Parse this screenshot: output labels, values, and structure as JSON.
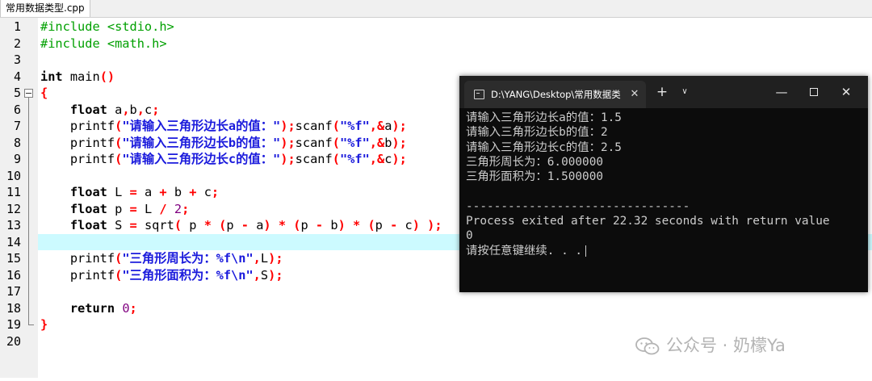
{
  "editor": {
    "tab_label": "常用数据类型.cpp",
    "highlighted_line": 14,
    "lines": [
      {
        "n": "1",
        "tokens": [
          {
            "c": "pp",
            "t": "#include <stdio.h>"
          }
        ]
      },
      {
        "n": "2",
        "tokens": [
          {
            "c": "pp",
            "t": "#include <math.h>"
          }
        ]
      },
      {
        "n": "3",
        "tokens": []
      },
      {
        "n": "4",
        "tokens": [
          {
            "c": "kw",
            "t": "int"
          },
          {
            "c": "plain",
            "t": " main"
          },
          {
            "c": "op",
            "t": "()"
          }
        ]
      },
      {
        "n": "5",
        "tokens": [
          {
            "c": "op",
            "t": "{"
          }
        ]
      },
      {
        "n": "6",
        "tokens": [
          {
            "c": "plain",
            "t": "    "
          },
          {
            "c": "kw",
            "t": "float"
          },
          {
            "c": "plain",
            "t": " a"
          },
          {
            "c": "op",
            "t": ","
          },
          {
            "c": "plain",
            "t": "b"
          },
          {
            "c": "op",
            "t": ","
          },
          {
            "c": "plain",
            "t": "c"
          },
          {
            "c": "op",
            "t": ";"
          }
        ]
      },
      {
        "n": "7",
        "tokens": [
          {
            "c": "plain",
            "t": "    printf"
          },
          {
            "c": "op",
            "t": "("
          },
          {
            "c": "str",
            "t": "\"请输入三角形边长a的值：\""
          },
          {
            "c": "op",
            "t": ");"
          },
          {
            "c": "plain",
            "t": "scanf"
          },
          {
            "c": "op",
            "t": "("
          },
          {
            "c": "str",
            "t": "\"%f\""
          },
          {
            "c": "op",
            "t": ",&"
          },
          {
            "c": "plain",
            "t": "a"
          },
          {
            "c": "op",
            "t": ");"
          }
        ]
      },
      {
        "n": "8",
        "tokens": [
          {
            "c": "plain",
            "t": "    printf"
          },
          {
            "c": "op",
            "t": "("
          },
          {
            "c": "str",
            "t": "\"请输入三角形边长b的值：\""
          },
          {
            "c": "op",
            "t": ");"
          },
          {
            "c": "plain",
            "t": "scanf"
          },
          {
            "c": "op",
            "t": "("
          },
          {
            "c": "str",
            "t": "\"%f\""
          },
          {
            "c": "op",
            "t": ",&"
          },
          {
            "c": "plain",
            "t": "b"
          },
          {
            "c": "op",
            "t": ");"
          }
        ]
      },
      {
        "n": "9",
        "tokens": [
          {
            "c": "plain",
            "t": "    printf"
          },
          {
            "c": "op",
            "t": "("
          },
          {
            "c": "str",
            "t": "\"请输入三角形边长c的值：\""
          },
          {
            "c": "op",
            "t": ");"
          },
          {
            "c": "plain",
            "t": "scanf"
          },
          {
            "c": "op",
            "t": "("
          },
          {
            "c": "str",
            "t": "\"%f\""
          },
          {
            "c": "op",
            "t": ",&"
          },
          {
            "c": "plain",
            "t": "c"
          },
          {
            "c": "op",
            "t": ");"
          }
        ]
      },
      {
        "n": "10",
        "tokens": []
      },
      {
        "n": "11",
        "tokens": [
          {
            "c": "plain",
            "t": "    "
          },
          {
            "c": "kw",
            "t": "float"
          },
          {
            "c": "plain",
            "t": " L "
          },
          {
            "c": "op",
            "t": "="
          },
          {
            "c": "plain",
            "t": " a "
          },
          {
            "c": "op",
            "t": "+"
          },
          {
            "c": "plain",
            "t": " b "
          },
          {
            "c": "op",
            "t": "+"
          },
          {
            "c": "plain",
            "t": " c"
          },
          {
            "c": "op",
            "t": ";"
          }
        ]
      },
      {
        "n": "12",
        "tokens": [
          {
            "c": "plain",
            "t": "    "
          },
          {
            "c": "kw",
            "t": "float"
          },
          {
            "c": "plain",
            "t": " p "
          },
          {
            "c": "op",
            "t": "="
          },
          {
            "c": "plain",
            "t": " L "
          },
          {
            "c": "op",
            "t": "/"
          },
          {
            "c": "plain",
            "t": " "
          },
          {
            "c": "num",
            "t": "2"
          },
          {
            "c": "op",
            "t": ";"
          }
        ]
      },
      {
        "n": "13",
        "tokens": [
          {
            "c": "plain",
            "t": "    "
          },
          {
            "c": "kw",
            "t": "float"
          },
          {
            "c": "plain",
            "t": " S "
          },
          {
            "c": "op",
            "t": "="
          },
          {
            "c": "plain",
            "t": " sqrt"
          },
          {
            "c": "op",
            "t": "("
          },
          {
            "c": "plain",
            "t": " p "
          },
          {
            "c": "op",
            "t": "*"
          },
          {
            "c": "plain",
            "t": " "
          },
          {
            "c": "op",
            "t": "("
          },
          {
            "c": "plain",
            "t": "p "
          },
          {
            "c": "op",
            "t": "-"
          },
          {
            "c": "plain",
            "t": " a"
          },
          {
            "c": "op",
            "t": ")"
          },
          {
            "c": "plain",
            "t": " "
          },
          {
            "c": "op",
            "t": "*"
          },
          {
            "c": "plain",
            "t": " "
          },
          {
            "c": "op",
            "t": "("
          },
          {
            "c": "plain",
            "t": "p "
          },
          {
            "c": "op",
            "t": "-"
          },
          {
            "c": "plain",
            "t": " b"
          },
          {
            "c": "op",
            "t": ")"
          },
          {
            "c": "plain",
            "t": " "
          },
          {
            "c": "op",
            "t": "*"
          },
          {
            "c": "plain",
            "t": " "
          },
          {
            "c": "op",
            "t": "("
          },
          {
            "c": "plain",
            "t": "p "
          },
          {
            "c": "op",
            "t": "-"
          },
          {
            "c": "plain",
            "t": " c"
          },
          {
            "c": "op",
            "t": ")"
          },
          {
            "c": "plain",
            "t": " "
          },
          {
            "c": "op",
            "t": ");"
          }
        ]
      },
      {
        "n": "14",
        "tokens": []
      },
      {
        "n": "15",
        "tokens": [
          {
            "c": "plain",
            "t": "    printf"
          },
          {
            "c": "op",
            "t": "("
          },
          {
            "c": "str",
            "t": "\"三角形周长为：%f\\n\""
          },
          {
            "c": "op",
            "t": ","
          },
          {
            "c": "plain",
            "t": "L"
          },
          {
            "c": "op",
            "t": ");"
          }
        ]
      },
      {
        "n": "16",
        "tokens": [
          {
            "c": "plain",
            "t": "    printf"
          },
          {
            "c": "op",
            "t": "("
          },
          {
            "c": "str",
            "t": "\"三角形面积为：%f\\n\""
          },
          {
            "c": "op",
            "t": ","
          },
          {
            "c": "plain",
            "t": "S"
          },
          {
            "c": "op",
            "t": ");"
          }
        ]
      },
      {
        "n": "17",
        "tokens": []
      },
      {
        "n": "18",
        "tokens": [
          {
            "c": "plain",
            "t": "    "
          },
          {
            "c": "kw",
            "t": "return"
          },
          {
            "c": "plain",
            "t": " "
          },
          {
            "c": "num",
            "t": "0"
          },
          {
            "c": "op",
            "t": ";"
          }
        ]
      },
      {
        "n": "19",
        "tokens": [
          {
            "c": "op",
            "t": "}"
          }
        ]
      },
      {
        "n": "20",
        "tokens": []
      }
    ]
  },
  "console": {
    "tab_title": "D:\\YANG\\Desktop\\常用数据类",
    "close_tab_glyph": "✕",
    "new_tab_glyph": "+",
    "dropdown_glyph": "∨",
    "minimize_glyph": "—",
    "close_glyph": "✕",
    "output": [
      "请输入三角形边长a的值：1.5",
      "请输入三角形边长b的值：2",
      "请输入三角形边长c的值：2.5",
      "三角形周长为：6.000000",
      "三角形面积为：1.500000",
      "",
      "--------------------------------",
      "Process exited after 22.32 seconds with return value",
      "0",
      "请按任意键继续. . ."
    ]
  },
  "watermark": {
    "text": "公众号 · 奶檬Ya",
    "icon": "wechat-icon"
  },
  "colors": {
    "keyword": "#000000",
    "preprocessor": "#00a000",
    "string": "#1a1adc",
    "operator": "#ff0000",
    "number": "#800080",
    "current_line": "#ccfaff",
    "console_bg": "#0c0c0c"
  }
}
